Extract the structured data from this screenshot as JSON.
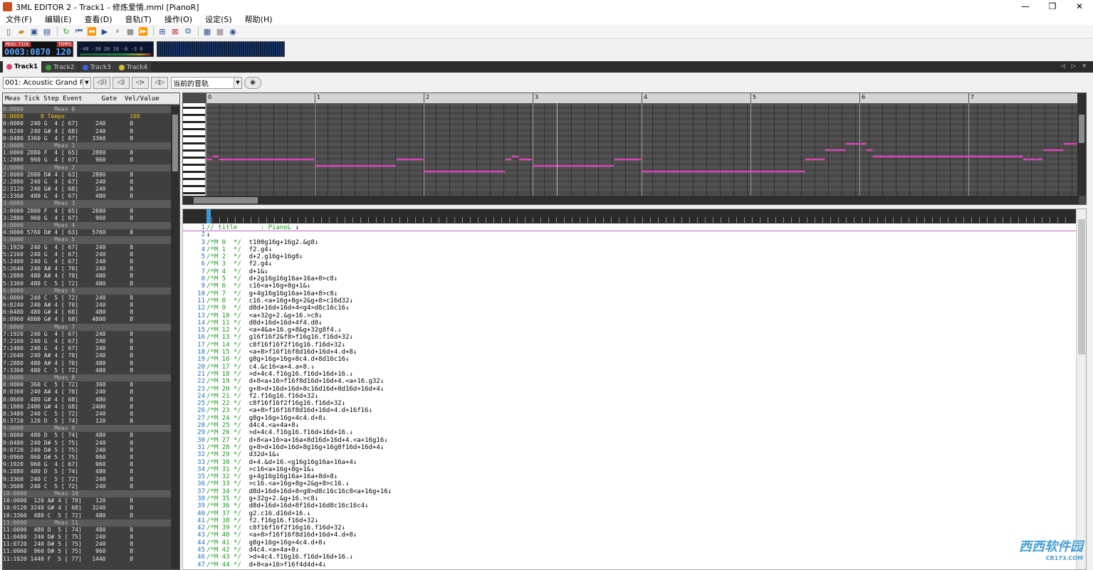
{
  "window": {
    "title": "3ML EDITOR 2 - Track1 - 修炼爱情.mml [PianoR]",
    "min_icon": "—",
    "max_icon": "❐",
    "close_icon": "✕"
  },
  "menu": [
    "文件(F)",
    "编辑(E)",
    "查看(D)",
    "音轨(T)",
    "操作(O)",
    "设定(S)",
    "帮助(H)"
  ],
  "transport": {
    "label_meas": "MEAS:TICK",
    "label_tempo": "TEMPO",
    "position": "0003:0870",
    "tempo": "120",
    "meter_scale": "-40  -30    20 10 -6 -3 0"
  },
  "tracks": [
    "Track1",
    "Track2",
    "Track3",
    "Track4"
  ],
  "track_colors": [
    "#e04080",
    "#40a040",
    "#4060e0",
    "#d0c030"
  ],
  "tab_nav": "◁ ▷ ✕",
  "instrument": {
    "selected": "001: Acoustic Grand Pia",
    "track_select": "当前的音轨"
  },
  "event_header": "Meas Tick Step Event     Gate  Vel/Value",
  "events": [
    {
      "t": "m",
      "text": "0:0000         Meas 0"
    },
    {
      "t": "p",
      "text": "0:0000     0 Tempo                   100"
    },
    {
      "t": "e",
      "text": "0:0000  240 G  4 [ 67]     240       8"
    },
    {
      "t": "e",
      "text": "0:0240  240 G# 4 [ 68]     240       8"
    },
    {
      "t": "e",
      "text": "0:0480 3360 G  4 [ 67]    3360       8"
    },
    {
      "t": "m",
      "text": "1:0000         Meas 1"
    },
    {
      "t": "e",
      "text": "1:0000 2880 F  4 [ 65]    2880       8"
    },
    {
      "t": "e",
      "text": "1:2880  960 G  4 [ 67]     960       8"
    },
    {
      "t": "m",
      "text": "2:0000         Meas 2"
    },
    {
      "t": "e",
      "text": "2:0000 2880 D# 4 [ 63]    2880       8"
    },
    {
      "t": "e",
      "text": "2:2880  240 G  4 [ 67]     240       8"
    },
    {
      "t": "e",
      "text": "2:3120  240 G# 4 [ 68]     240       8"
    },
    {
      "t": "e",
      "text": "2:3360  480 G  4 [ 67]     480       8"
    },
    {
      "t": "m",
      "text": "3:0000         Meas 3"
    },
    {
      "t": "e",
      "text": "3:0000 2880 F  4 [ 65]    2880       8"
    },
    {
      "t": "e",
      "text": "3:2880  960 G  4 [ 67]     960       8"
    },
    {
      "t": "m",
      "text": "4:0000         Meas 4"
    },
    {
      "t": "e",
      "text": "4:0000 5760 D# 4 [ 63]    5760       8"
    },
    {
      "t": "m",
      "text": "5:0000         Meas 5"
    },
    {
      "t": "e",
      "text": "5:1920  240 G  4 [ 67]     240       8"
    },
    {
      "t": "e",
      "text": "5:2160  240 G  4 [ 67]     240       8"
    },
    {
      "t": "e",
      "text": "5:2400  240 G  4 [ 67]     240       8"
    },
    {
      "t": "e",
      "text": "5:2640  240 A# 4 [ 70]     240       8"
    },
    {
      "t": "e",
      "text": "5:2880  480 A# 4 [ 70]     480       8"
    },
    {
      "t": "e",
      "text": "5:3360  480 C  5 [ 72]     480       8"
    },
    {
      "t": "m",
      "text": "6:0000         Meas 6"
    },
    {
      "t": "e",
      "text": "6:0000  240 C  5 [ 72]     240       8"
    },
    {
      "t": "e",
      "text": "6:0240  240 A# 4 [ 70]     240       8"
    },
    {
      "t": "e",
      "text": "6:0480  480 G# 4 [ 68]     480       8"
    },
    {
      "t": "e",
      "text": "6:0960 4800 G# 4 [ 68]    4800       8"
    },
    {
      "t": "m",
      "text": "7:0000         Meas 7"
    },
    {
      "t": "e",
      "text": "7:1920  240 G  4 [ 67]     240       8"
    },
    {
      "t": "e",
      "text": "7:2160  240 G  4 [ 67]     240       8"
    },
    {
      "t": "e",
      "text": "7:2400  240 G  4 [ 67]     240       8"
    },
    {
      "t": "e",
      "text": "7:2640  240 A# 4 [ 70]     240       8"
    },
    {
      "t": "e",
      "text": "7:2880  480 A# 4 [ 70]     480       8"
    },
    {
      "t": "e",
      "text": "7:3360  480 C  5 [ 72]     480       8"
    },
    {
      "t": "m",
      "text": "8:0000         Meas 8"
    },
    {
      "t": "e",
      "text": "8:0000  360 C  5 [ 72]     360       8"
    },
    {
      "t": "e",
      "text": "8:0360  240 A# 4 [ 70]     240       8"
    },
    {
      "t": "e",
      "text": "8:0600  480 G# 4 [ 68]     480       8"
    },
    {
      "t": "e",
      "text": "8:1080 2400 G# 4 [ 68]    2400       8"
    },
    {
      "t": "e",
      "text": "8:3480  240 C  5 [ 72]     240       8"
    },
    {
      "t": "e",
      "text": "8:3720  120 D  5 [ 74]     120       8"
    },
    {
      "t": "m",
      "text": "9:0000         Meas 9"
    },
    {
      "t": "e",
      "text": "9:0000  480 D  5 [ 74]     480       8"
    },
    {
      "t": "e",
      "text": "9:0480  240 D# 5 [ 75]     240       8"
    },
    {
      "t": "e",
      "text": "9:0720  240 D# 5 [ 75]     240       8"
    },
    {
      "t": "e",
      "text": "9:0960  960 D# 5 [ 75]     960       8"
    },
    {
      "t": "e",
      "text": "9:1920  960 G  4 [ 67]     960       8"
    },
    {
      "t": "e",
      "text": "9:2880  480 D  5 [ 74]     480       8"
    },
    {
      "t": "e",
      "text": "9:3360  240 C  5 [ 72]     240       8"
    },
    {
      "t": "e",
      "text": "9:3600  240 C  5 [ 72]     240       8"
    },
    {
      "t": "m",
      "text": "10:0000        Meas 10"
    },
    {
      "t": "e",
      "text": "10:0000  120 A# 4 [ 70]    120       8"
    },
    {
      "t": "e",
      "text": "10:0120 3240 G# 4 [ 68]   3240       8"
    },
    {
      "t": "e",
      "text": "10:3360  480 C  5 [ 72]    480       8"
    },
    {
      "t": "m",
      "text": "11:0000        Meas 11"
    },
    {
      "t": "e",
      "text": "11:0000  480 D  5 [ 74]    480       8"
    },
    {
      "t": "e",
      "text": "11:0480  240 D# 5 [ 75]    240       8"
    },
    {
      "t": "e",
      "text": "11:0720  240 D# 5 [ 75]    240       8"
    },
    {
      "t": "e",
      "text": "11:0960  960 D# 5 [ 75]    960       8"
    },
    {
      "t": "e",
      "text": "11:1920 1440 F  5 [ 77]   1440       8"
    }
  ],
  "ruler_marks": [
    "0",
    "1",
    "2",
    "3",
    "4",
    "5",
    "6",
    "7"
  ],
  "mml_lines": [
    {
      "n": "1",
      "c": "// title      : PianoL",
      "code": " ↓"
    },
    {
      "n": "2",
      "c": "",
      "code": "↓"
    },
    {
      "n": "3",
      "c": "/*M 0  */",
      "code": "  t100g16g+16g2.&g8↓"
    },
    {
      "n": "4",
      "c": "/*M 1  */",
      "code": "  f2.g4↓"
    },
    {
      "n": "5",
      "c": "/*M 2  */",
      "code": "  d+2.g16g+16g8↓"
    },
    {
      "n": "6",
      "c": "/*M 3  */",
      "code": "  f2.g4↓"
    },
    {
      "n": "7",
      "c": "/*M 4  */",
      "code": "  d+1&↓"
    },
    {
      "n": "8",
      "c": "/*M 5  */",
      "code": "  d+2g16g16g16a+16a+8>c8↓"
    },
    {
      "n": "9",
      "c": "/*M 6  */",
      "code": "  c16<a+16g+8g+1&↓"
    },
    {
      "n": "10",
      "c": "/*M 7  */",
      "code": "  g+4g16g16g16a+16a+8>c8↓"
    },
    {
      "n": "11",
      "c": "/*M 8  */",
      "code": "  c16.<a+16g+8g+2&g+8>c16d32↓"
    },
    {
      "n": "12",
      "c": "/*M 9  */",
      "code": "  d8d+16d+16d+4<g4>d8c16c16↓"
    },
    {
      "n": "13",
      "c": "/*M 10 */",
      "code": "  <a+32g+2.&g+16.>c8↓"
    },
    {
      "n": "14",
      "c": "/*M 11 */",
      "code": "  d8d+16d+16d+4f4.d8↓"
    },
    {
      "n": "15",
      "c": "/*M 12 */",
      "code": "  <a+4&a+16.g+8&g+32g8f4.↓"
    },
    {
      "n": "16",
      "c": "/*M 13 */",
      "code": "  g16f16f2&f8>f16g16.f16d+32↓"
    },
    {
      "n": "17",
      "c": "/*M 14 */",
      "code": "  c8f16f16f2f16g16.f16d+32↓"
    },
    {
      "n": "18",
      "c": "/*M 15 */",
      "code": "  <a+8>f16f16f8d16d+16d+4.d+8↓"
    },
    {
      "n": "19",
      "c": "/*M 16 */",
      "code": "  g8g+16g+16g+8c4.d+8d16c16↓"
    },
    {
      "n": "20",
      "c": "/*M 17 */",
      "code": "  c4.&c16<a+4.a+8.↓"
    },
    {
      "n": "21",
      "c": "/*M 18 */",
      "code": "  >d+4c4.f16g16.f16d+16d+16.↓"
    },
    {
      "n": "22",
      "c": "/*M 19 */",
      "code": "  d+8<a+16>f16f8d16d+16d+4.<a+16.g32↓"
    },
    {
      "n": "23",
      "c": "/*M 20 */",
      "code": "  g+8>d+16d+16d+8c16d16d+8d16d+16d+4↓"
    },
    {
      "n": "24",
      "c": "/*M 21 */",
      "code": "  f2.f16g16.f16d+32↓"
    },
    {
      "n": "25",
      "c": "/*M 22 */",
      "code": "  c8f16f16f2f16g16.f16d+32↓"
    },
    {
      "n": "26",
      "c": "/*M 23 */",
      "code": "  <a+8>f16f16f8d16d+16d+4.d+16f16↓"
    },
    {
      "n": "27",
      "c": "/*M 24 */",
      "code": "  g8g+16g+16g+4c4.d+8↓"
    },
    {
      "n": "28",
      "c": "/*M 25 */",
      "code": "  d4c4.<a+4a+8↓"
    },
    {
      "n": "29",
      "c": "/*M 26 */",
      "code": "  >d+4c4.f16g16.f16d+16d+16.↓"
    },
    {
      "n": "30",
      "c": "/*M 27 */",
      "code": "  d+8<a+16>a+16a+8d16d+16d+4.<a+16g16↓"
    },
    {
      "n": "31",
      "c": "/*M 28 */",
      "code": "  g+8>d+16d+16d+8g16g+16g8f16d+16d+4↓"
    },
    {
      "n": "32",
      "c": "/*M 29 */",
      "code": "  d32d+1&↓"
    },
    {
      "n": "33",
      "c": "/*M 30 */",
      "code": "  d+4.&d+16.<g16g16g16a+16a+4↓"
    },
    {
      "n": "34",
      "c": "/*M 31 */",
      "code": "  >c16<a+16g+8g+1&↓"
    },
    {
      "n": "35",
      "c": "/*M 32 */",
      "code": "  g+4g16g16g16a+16a+8d+8↓"
    },
    {
      "n": "36",
      "c": "/*M 33 */",
      "code": "  >c16.<a+16g+8g+2&g+8>c16.↓"
    },
    {
      "n": "37",
      "c": "/*M 34 */",
      "code": "  d8d+16d+16d+8<g8>d8c16c16c8<a+16g+16↓"
    },
    {
      "n": "38",
      "c": "/*M 35 */",
      "code": "  g+32g+2.&g+16.>c8↓"
    },
    {
      "n": "39",
      "c": "/*M 36 */",
      "code": "  d8d+16d+16d+8f16d+16d8c16c16c4↓"
    },
    {
      "n": "40",
      "c": "/*M 37 */",
      "code": "  g2.c16.d16d+16.↓"
    },
    {
      "n": "41",
      "c": "/*M 38 */",
      "code": "  f2.f16g16.f16d+32↓"
    },
    {
      "n": "42",
      "c": "/*M 39 */",
      "code": "  c8f16f16f2f16g16.f16d+32↓"
    },
    {
      "n": "43",
      "c": "/*M 40 */",
      "code": "  <a+8>f16f16f8d16d+16d+4.d+8↓"
    },
    {
      "n": "44",
      "c": "/*M 41 */",
      "code": "  g8g+16g+16g+4c4.d+8↓"
    },
    {
      "n": "45",
      "c": "/*M 42 */",
      "code": "  d4c4.<a+4a+8↓"
    },
    {
      "n": "46",
      "c": "/*M 43 */",
      "code": "  >d+4c4.f16g16.f16d+16d+16.↓"
    },
    {
      "n": "47",
      "c": "/*M 44 */",
      "code": "  d+8<a+16>f16f4d4d+4↓"
    }
  ],
  "roll_notes": [
    {
      "bar": 0.0,
      "dur": 0.0625,
      "pitch": 67
    },
    {
      "bar": 0.0625,
      "dur": 0.0625,
      "pitch": 68
    },
    {
      "bar": 0.125,
      "dur": 0.875,
      "pitch": 67
    },
    {
      "bar": 1.0,
      "dur": 0.75,
      "pitch": 65
    },
    {
      "bar": 1.75,
      "dur": 0.25,
      "pitch": 67
    },
    {
      "bar": 2.0,
      "dur": 0.75,
      "pitch": 63
    },
    {
      "bar": 2.75,
      "dur": 0.0625,
      "pitch": 67
    },
    {
      "bar": 2.8125,
      "dur": 0.0625,
      "pitch": 68
    },
    {
      "bar": 2.875,
      "dur": 0.125,
      "pitch": 67
    },
    {
      "bar": 3.0,
      "dur": 0.75,
      "pitch": 65
    },
    {
      "bar": 3.75,
      "dur": 0.25,
      "pitch": 67
    },
    {
      "bar": 4.0,
      "dur": 1.5,
      "pitch": 63
    },
    {
      "bar": 5.5,
      "dur": 0.0625,
      "pitch": 67
    },
    {
      "bar": 5.5625,
      "dur": 0.0625,
      "pitch": 67
    },
    {
      "bar": 5.625,
      "dur": 0.0625,
      "pitch": 67
    },
    {
      "bar": 5.6875,
      "dur": 0.0625,
      "pitch": 70
    },
    {
      "bar": 5.75,
      "dur": 0.125,
      "pitch": 70
    },
    {
      "bar": 5.875,
      "dur": 0.125,
      "pitch": 72
    },
    {
      "bar": 6.0,
      "dur": 0.0625,
      "pitch": 72
    },
    {
      "bar": 6.0625,
      "dur": 0.0625,
      "pitch": 70
    },
    {
      "bar": 6.125,
      "dur": 0.125,
      "pitch": 68
    },
    {
      "bar": 6.25,
      "dur": 1.25,
      "pitch": 68
    },
    {
      "bar": 7.5,
      "dur": 0.0625,
      "pitch": 67
    },
    {
      "bar": 7.5625,
      "dur": 0.0625,
      "pitch": 67
    },
    {
      "bar": 7.625,
      "dur": 0.0625,
      "pitch": 67
    },
    {
      "bar": 7.6875,
      "dur": 0.0625,
      "pitch": 70
    },
    {
      "bar": 7.75,
      "dur": 0.125,
      "pitch": 70
    },
    {
      "bar": 7.875,
      "dur": 0.125,
      "pitch": 72
    }
  ],
  "playhead_bar": 3.22,
  "watermark": {
    "main": "西西软件园",
    "sub": "CR173.COM"
  }
}
